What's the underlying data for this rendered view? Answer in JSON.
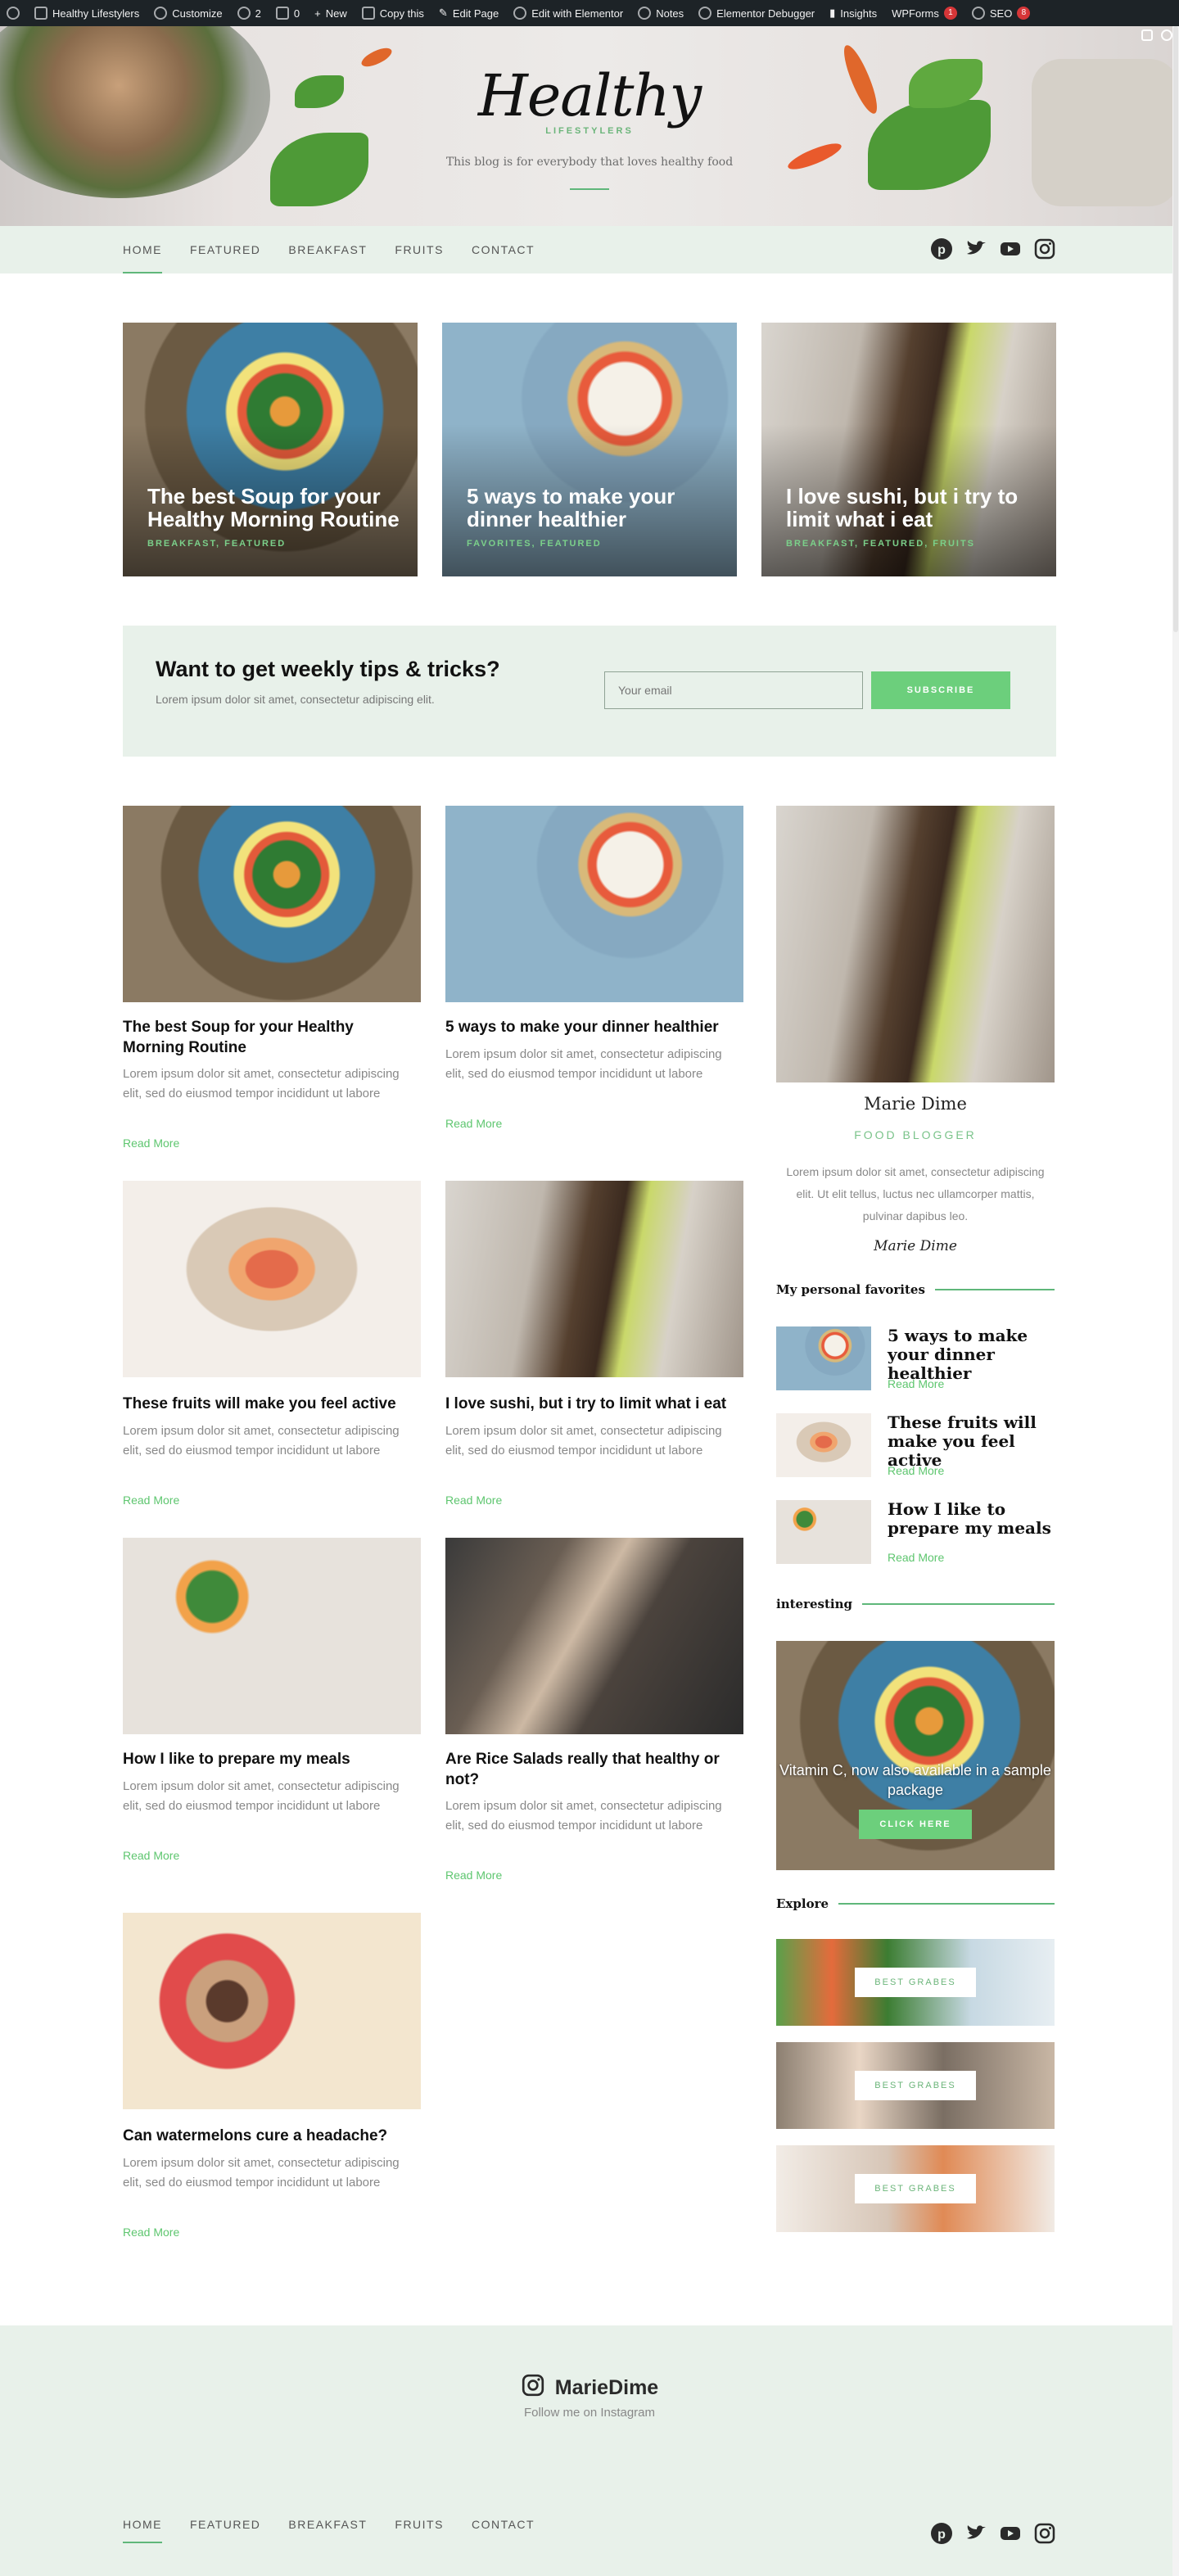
{
  "adminbar": {
    "items": [
      {
        "label": "Healthy Lifestylers",
        "icon": "home-icon"
      },
      {
        "label": "Customize",
        "icon": "brush-icon"
      },
      {
        "label": "2",
        "icon": "refresh-icon"
      },
      {
        "label": "0",
        "icon": "comment-icon"
      },
      {
        "label": "New",
        "icon": "plus-icon"
      },
      {
        "label": "Copy this",
        "icon": "copy-icon"
      },
      {
        "label": "Edit Page",
        "icon": "pencil-icon"
      },
      {
        "label": "Edit with Elementor",
        "icon": "elementor-icon"
      },
      {
        "label": "Notes",
        "icon": "notes-icon"
      },
      {
        "label": "Elementor Debugger",
        "icon": "debugger-icon"
      },
      {
        "label": "Insights",
        "icon": "chart-icon"
      }
    ],
    "wpforms": {
      "label": "WPForms",
      "badge": "1"
    },
    "seo": {
      "label": "SEO",
      "badge": "8"
    }
  },
  "hero": {
    "logo": "Healthy",
    "logo_sub": "LIFESTYLERS",
    "tagline": "This blog is for everybody that loves healthy food"
  },
  "nav": {
    "items": [
      "HOME",
      "FEATURED",
      "BREAKFAST",
      "FRUITS",
      "CONTACT"
    ],
    "active": "HOME"
  },
  "featured": [
    {
      "title": "The best Soup for your Healthy Morning Routine",
      "cats": "BREAKFAST, FEATURED"
    },
    {
      "title": "5 ways to make your dinner healthier",
      "cats": "FAVORITES, FEATURED"
    },
    {
      "title": "I love sushi, but i try to limit what i eat",
      "cats": "BREAKFAST, FEATURED, FRUITS"
    }
  ],
  "newsletter": {
    "heading": "Want to get weekly tips & tricks?",
    "text": "Lorem ipsum dolor sit amet, consectetur adipiscing elit.",
    "placeholder": "Your email",
    "button": "SUBSCRIBE"
  },
  "posts": [
    {
      "title": "The best Soup for your Healthy Morning Routine",
      "excerpt": "Lorem ipsum dolor sit amet, consectetur adipiscing elit, sed do eiusmod tempor incididunt ut labore",
      "more": "Read More"
    },
    {
      "title": "5 ways to make your dinner healthier",
      "excerpt": "Lorem ipsum dolor sit amet, consectetur adipiscing elit, sed do eiusmod tempor incididunt ut labore",
      "more": "Read More"
    },
    {
      "title": "These fruits will make you feel active",
      "excerpt": "Lorem ipsum dolor sit amet, consectetur adipiscing elit, sed do eiusmod tempor incididunt ut labore",
      "more": "Read More"
    },
    {
      "title": "I love sushi, but i try to limit what i eat",
      "excerpt": "Lorem ipsum dolor sit amet, consectetur adipiscing elit, sed do eiusmod tempor incididunt ut labore",
      "more": "Read More"
    },
    {
      "title": "How I like to prepare my meals",
      "excerpt": "Lorem ipsum dolor sit amet, consectetur adipiscing elit, sed do eiusmod tempor incididunt ut labore",
      "more": "Read More"
    },
    {
      "title": "Are Rice Salads really that healthy or not?",
      "excerpt": "Lorem ipsum dolor sit amet, consectetur adipiscing elit, sed do eiusmod tempor incididunt ut labore",
      "more": "Read More"
    },
    {
      "title": "Can watermelons cure a headache?",
      "excerpt": "Lorem ipsum dolor sit amet, consectetur adipiscing elit, sed do eiusmod tempor incididunt ut labore",
      "more": "Read More"
    }
  ],
  "sidebar": {
    "name": "Marie Dime",
    "role": "FOOD BLOGGER",
    "bio": "Lorem ipsum dolor sit amet, consectetur adipiscing elit. Ut elit tellus, luctus nec ullamcorper mattis, pulvinar dapibus leo.",
    "signature": "Marie Dime",
    "favorites_heading": "My personal favorites",
    "favorites": [
      {
        "title": "5 ways to make your dinner healthier",
        "more": "Read More"
      },
      {
        "title": "These fruits will make you feel active",
        "more": "Read More"
      },
      {
        "title": "How I like to prepare my meals",
        "more": "Read More"
      }
    ],
    "interesting_heading": "interesting",
    "promo_text": "Vitamin C, now also available in a sample package",
    "promo_button": "CLICK HERE",
    "explore_heading": "Explore",
    "explore_buttons": [
      "BEST GRABES",
      "BEST GRABES",
      "BEST GRABES"
    ]
  },
  "footer": {
    "brand": "MarieDime",
    "follow": "Follow me on Instagram",
    "menu": [
      "HOME",
      "FEATURED",
      "BREAKFAST",
      "FRUITS",
      "CONTACT"
    ]
  },
  "colors": {
    "accent": "#6ccf7c",
    "band": "#e8f1ea",
    "admin": "#1d2327"
  }
}
